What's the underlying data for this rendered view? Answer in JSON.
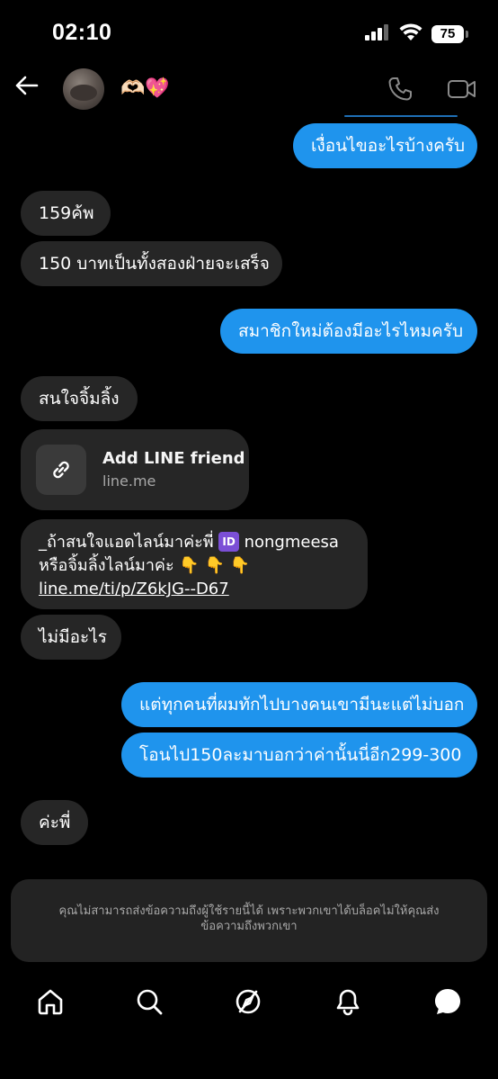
{
  "status_bar": {
    "time": "02:10",
    "battery": "75",
    "icons": [
      "signal-icon",
      "wifi-icon",
      "battery-icon"
    ]
  },
  "header": {
    "contact_name": "🫶🏻💖",
    "icons": [
      "back-arrow-icon",
      "phone-icon",
      "video-camera-icon"
    ]
  },
  "messages": [
    {
      "direction": "outgoing",
      "text": "เงื่อนไขอะไรบ้างครับ"
    },
    {
      "direction": "incoming",
      "text": "159ค้พ"
    },
    {
      "direction": "incoming",
      "text": "150 บาทเป็นทั้งสองฝ่ายจะเสร็จ"
    },
    {
      "direction": "outgoing",
      "text": "สมาชิกใหม่ต้องมีอะไรไหมครับ"
    },
    {
      "direction": "incoming",
      "text": "สนใจจิ้มลิ้ง"
    },
    {
      "direction": "incoming",
      "type": "link_card",
      "title": "Add LINE friend",
      "domain": "line.me"
    },
    {
      "direction": "incoming",
      "line1_prefix": "_ถ้าสนใจแอดไลน์มาค่ะพี่",
      "id_badge": "ID",
      "line1_suffix": "nongmeesa",
      "line2": "หรือจิ้มลิ้งไลน์มาค่ะ",
      "line2_emoji": "👇 👇 👇",
      "link": "line.me/ti/p/Z6kJG--D67"
    },
    {
      "direction": "incoming",
      "text": "ไม่มีอะไร"
    },
    {
      "direction": "outgoing",
      "text": "แต่ทุกคนที่ผมทักไปบางคนเขามีนะแต่ไม่บอก"
    },
    {
      "direction": "outgoing",
      "text": "โอนไป150ละมาบอกว่าค่านั้นนี่อีก299-300"
    },
    {
      "direction": "incoming",
      "text": "ค่ะพี่"
    }
  ],
  "blocked_notice": {
    "line1": "คุณไม่สามารถส่งข้อความถึงผู้ใช้รายนี้ได้ เพราะพวกเขาได้บล็อคไม่ให้คุณส่ง",
    "line2": "ข้อความถึงพวกเขา"
  },
  "bottom_nav": {
    "items": [
      "home-icon",
      "search-icon",
      "explore-icon",
      "notifications-icon",
      "messages-icon"
    ]
  },
  "colors": {
    "background": "#000000",
    "incoming_bubble": "#262626",
    "outgoing_bubble": "#1f94ed",
    "notice_background": "#232323"
  }
}
